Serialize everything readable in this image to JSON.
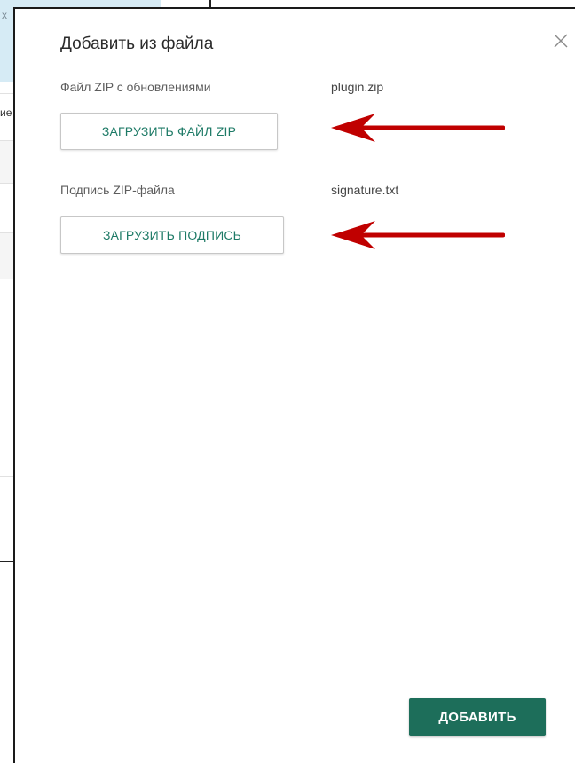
{
  "background": {
    "corner_mark": "x",
    "row_text": "ие"
  },
  "dialog": {
    "title": "Добавить из файла",
    "close_icon": "close-icon",
    "zip_field": {
      "label": "Файл ZIP с обновлениями",
      "value": "plugin.zip",
      "button_label": "ЗАГРУЗИТЬ ФАЙЛ ZIP"
    },
    "signature_field": {
      "label": "Подпись ZIP-файла",
      "value": "signature.txt",
      "button_label": "ЗАГРУЗИТЬ ПОДПИСЬ"
    },
    "add_button_label": "ДОБАВИТЬ"
  },
  "colors": {
    "accent": "#1d7a66",
    "primary_button": "#1d6e5a",
    "arrow_annotation": "#c00000",
    "background_panel": "#d6ebf5"
  }
}
